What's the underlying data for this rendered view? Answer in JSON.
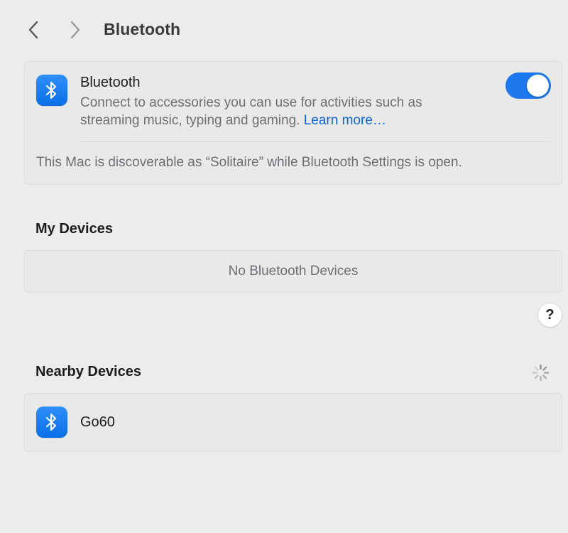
{
  "toolbar": {
    "back_icon": "chevron-left-icon",
    "forward_icon": "chevron-right-icon",
    "title": "Bluetooth"
  },
  "bluetooth": {
    "icon": "bluetooth-icon",
    "title": "Bluetooth",
    "description": "Connect to accessories you can use for activities such as streaming music, typing and gaming.",
    "learn_more": "Learn more…",
    "enabled": true,
    "discoverable_text": "This Mac is discoverable as “Solitaire” while Bluetooth Settings is open."
  },
  "my_devices": {
    "heading": "My Devices",
    "empty_text": "No Bluetooth Devices"
  },
  "help": {
    "label": "?"
  },
  "nearby_devices": {
    "heading": "Nearby Devices",
    "loading_icon": "spinner-icon",
    "devices": [
      {
        "name": "Go60",
        "icon": "bluetooth-icon"
      }
    ]
  },
  "colors": {
    "background": "#ececec",
    "card": "#e9e9e9",
    "accent": "#1c78ec",
    "link": "#0a66d8",
    "bluetooth_tile": "#0a6fe6",
    "secondary_text": "#6e6e73"
  }
}
